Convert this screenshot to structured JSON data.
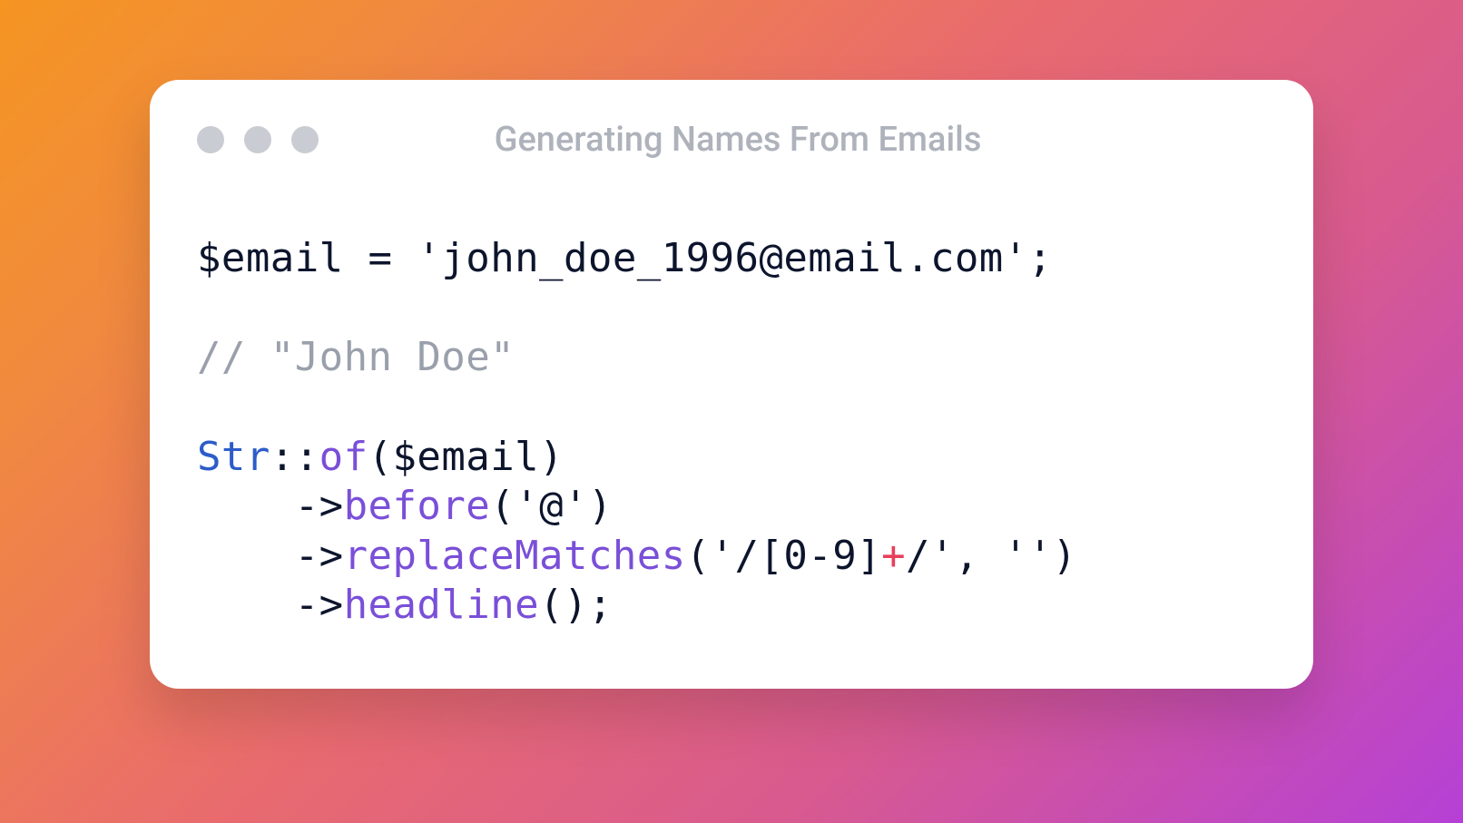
{
  "window": {
    "title": "Generating Names From Emails"
  },
  "code": {
    "var_email": "$email",
    "assign_op": "=",
    "email_value_quoted": "'john_doe_1996@email.com'",
    "semicolon": ";",
    "comment_line": "// \"John Doe\"",
    "class_str": "Str",
    "scope_op": "::",
    "method_of": "of",
    "paren_open": "(",
    "paren_close": ")",
    "arg_email": "$email",
    "arrow": "->",
    "method_before": "before",
    "before_arg": "'@'",
    "method_replace": "replaceMatches",
    "replace_arg_prefix": "'/[0-9]",
    "replace_arg_plus": "+",
    "replace_arg_suffix": "/'",
    "replace_arg_sep": ", ",
    "replace_arg_empty": "''",
    "method_headline": "headline",
    "indent": "    "
  }
}
